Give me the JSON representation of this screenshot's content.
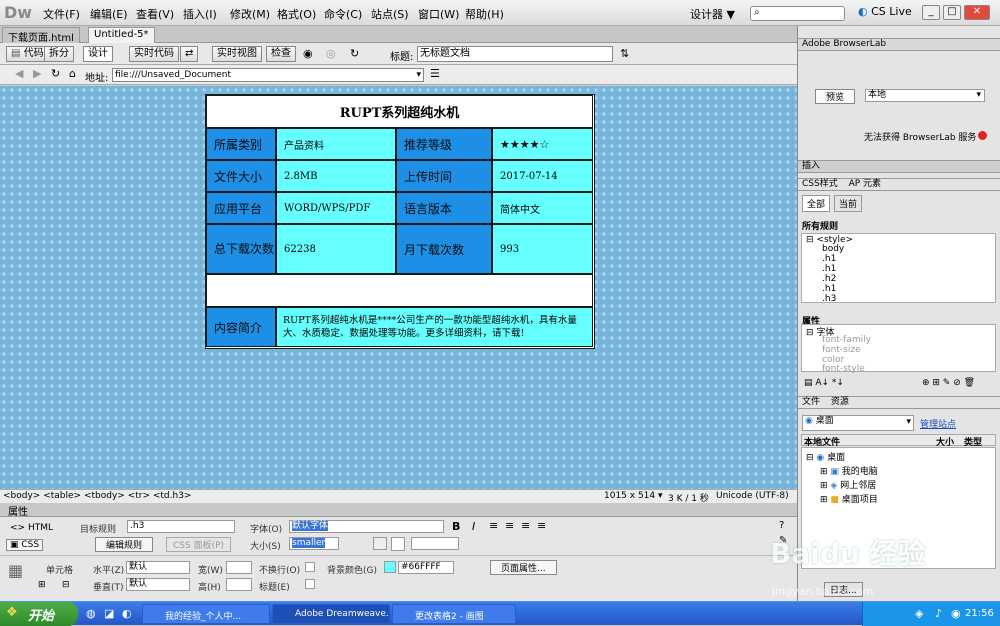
{
  "app": {
    "logo": "Dw",
    "cs_live": "CS Live",
    "layout_mode": "设计器 ▼"
  },
  "menu": [
    "文件(F)",
    "编辑(E)",
    "查看(V)",
    "插入(I)",
    "修改(M)",
    "格式(O)",
    "命令(C)",
    "站点(S)",
    "窗口(W)",
    "帮助(H)"
  ],
  "tabs": [
    "下载页面.html",
    "Untitled-5*"
  ],
  "toolbar": {
    "code": "代码",
    "split": "拆分",
    "design": "设计",
    "live_code": "实时代码",
    "live_view": "实时视图",
    "inspect": "检查",
    "title_label": "标题:",
    "title_value": "无标题文档"
  },
  "address": {
    "label": "地址:",
    "value": "file:///Unsaved_Document"
  },
  "content_table": {
    "title": "RUPT系列超纯水机",
    "rows": [
      {
        "label1": "所属类别",
        "value1": "产品资料",
        "label2": "推荐等级",
        "value2": "★★★★☆"
      },
      {
        "label1": "文件大小",
        "value1": "2.8MB",
        "label2": "上传时间",
        "value2": "2017-07-14"
      },
      {
        "label1": "应用平台",
        "value1": "WORD/WPS/PDF",
        "label2": "语言版本",
        "value2": "简体中文"
      },
      {
        "label1": "总下载次数",
        "value1": "62238",
        "label2": "月下载次数",
        "value2": "993"
      }
    ],
    "intro_label": "内容简介",
    "intro_text": "RUPT系列超纯水机是****公司生产的一款功能型超纯水机，具有水量大、水质稳定、数据处理等功能。更多详细资料，请下载!"
  },
  "status": {
    "tags": "<body> <table> <tbody> <tr> <td.h3>",
    "dimensions": "1015 x 514 ▾",
    "size": "3 K / 1 秒",
    "encoding": "Unicode (UTF-8)"
  },
  "properties": {
    "title": "属性",
    "html": "HTML",
    "css": "CSS",
    "target_rule_label": "目标规则",
    "target_rule": ".h3",
    "edit_rule": "编辑规则",
    "css_panel": "CSS 面板(P)",
    "font_label": "字体(O)",
    "font_value": "默认字体",
    "size_label": "大小(S)",
    "size_value": "smaller",
    "cell_label": "单元格",
    "horz_label": "水平(Z)",
    "horz_value": "默认",
    "vert_label": "垂直(T)",
    "vert_value": "默认",
    "width_label": "宽(W)",
    "height_label": "高(H)",
    "nowrap_label": "不换行(O)",
    "header_label": "标题(E)",
    "bg_label": "背景颜色(G)",
    "bg_value": "#66FFFF",
    "page_props": "页面属性..."
  },
  "right_panel": {
    "browserlab_title": "Adobe BrowserLab",
    "preview": "预览",
    "local": "本地",
    "browserlab_msg": "无法获得 BrowserLab 服务",
    "insert": "插入",
    "css_styles": "CSS样式",
    "ap_elements": "AP 元素",
    "all": "全部",
    "current": "当前",
    "all_rules": "所有规则",
    "rules": [
      "<style>",
      "body",
      ".h1",
      ".h1",
      ".h2",
      ".h1",
      ".h3"
    ],
    "props_label": "属性",
    "font_group": "字体",
    "font_props": [
      "font-family",
      "font-size",
      "color",
      "font-style"
    ],
    "files": "文件",
    "assets": "资源",
    "site": "桌面",
    "manage_sites": "管理站点",
    "local_files": "本地文件",
    "size_col": "大小",
    "type_col": "类型",
    "tree": [
      "桌面",
      "我的电脑",
      "网上邻居",
      "桌面项目"
    ],
    "log": "日志..."
  },
  "taskbar": {
    "start": "开始",
    "tasks": [
      "我的经验_个人中...",
      "Adobe Dreamweave...",
      "更改表格2 - 画图"
    ],
    "clock": "21:56"
  },
  "watermark": "Baidu 经验",
  "watermark_url": "jingyan.baidu.com"
}
